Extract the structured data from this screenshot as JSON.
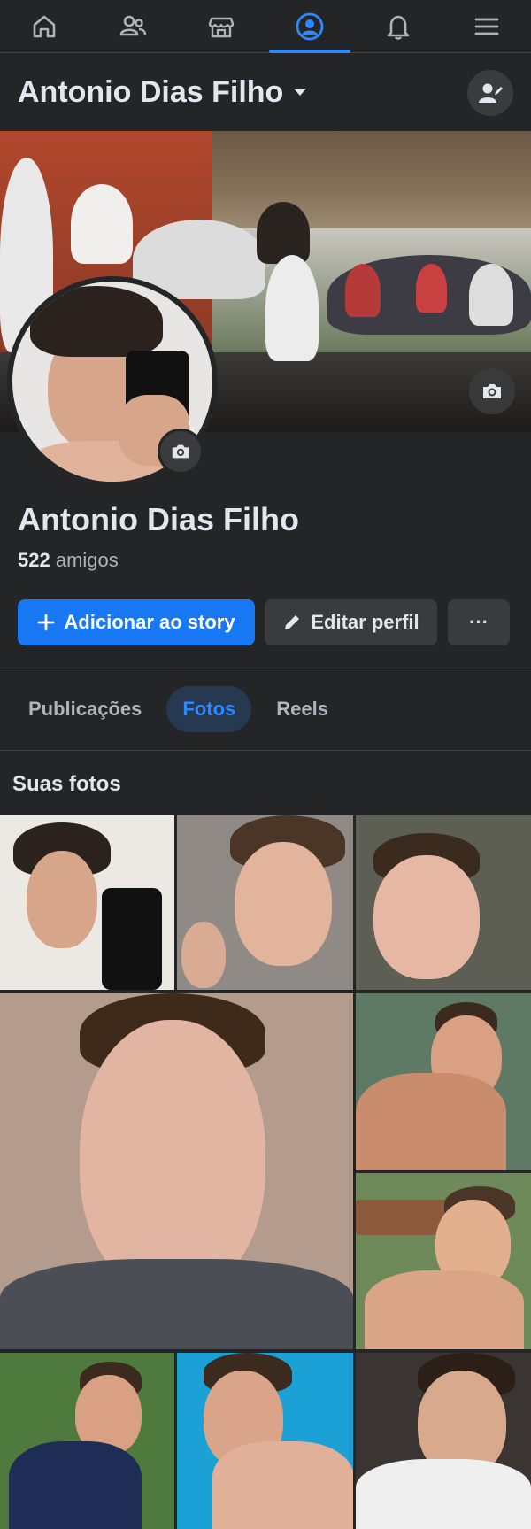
{
  "nav": {
    "items": [
      {
        "icon": "home-icon",
        "active": false
      },
      {
        "icon": "friends-icon",
        "active": false
      },
      {
        "icon": "marketplace-icon",
        "active": false
      },
      {
        "icon": "profile-icon",
        "active": true
      },
      {
        "icon": "bell-icon",
        "active": false
      },
      {
        "icon": "menu-icon",
        "active": false
      }
    ],
    "accent": "#2d88ff"
  },
  "header": {
    "name": "Antonio Dias Filho",
    "add_icon": "add-user-icon"
  },
  "profile": {
    "name": "Antonio Dias Filho",
    "friends_count": "522",
    "friends_label": " amigos",
    "cover_camera_icon": "camera-icon",
    "avatar_camera_icon": "camera-icon"
  },
  "actions": {
    "story_label": "Adicionar ao story",
    "edit_label": "Editar perfil",
    "more_label": "···",
    "story_color": "#1877f2"
  },
  "tabs": [
    {
      "label": "Publicações",
      "active": false
    },
    {
      "label": "Fotos",
      "active": true
    },
    {
      "label": "Reels",
      "active": false
    }
  ],
  "photos": {
    "title": "Suas fotos"
  }
}
